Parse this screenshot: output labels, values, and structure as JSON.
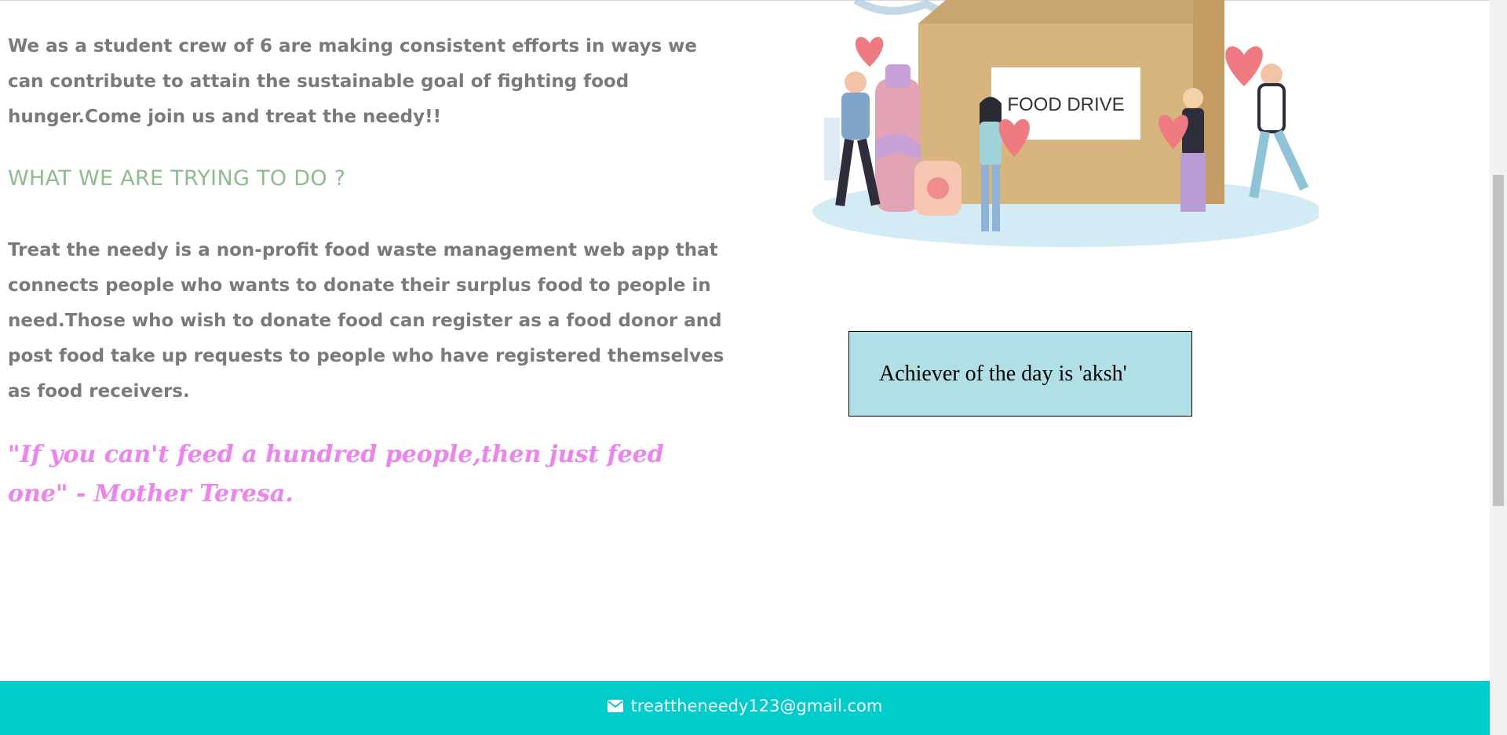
{
  "about": {
    "intro": "We as a student crew of 6 are making consistent efforts in ways we can contribute to attain the sustainable goal of fighting food hunger.Come join us and treat the needy!!",
    "heading": "WHAT WE ARE TRYING TO DO ?",
    "mission": "Treat the needy is a non-profit food waste management web app that connects people who wants to donate their surplus food to people in need.Those who wish to donate food can register as a food donor and post food take up requests to people who have registered themselves as food receivers.",
    "quote": "\"If you can't feed a hundred people,then just feed one\" - Mother Teresa."
  },
  "illustration": {
    "sign_text": "FOOD DRIVE",
    "icon": "food-drive-illustration"
  },
  "achiever": {
    "text": "Achiever of the day is 'aksh'"
  },
  "footer": {
    "email": "treattheneedy123@gmail.com",
    "icon": "envelope-icon"
  },
  "colors": {
    "heading": "#8fbc8f",
    "body_text": "#7a7a7a",
    "quote": "#ee82ee",
    "achiever_bg": "#b0e0e6",
    "footer_bg": "#00cccc"
  }
}
